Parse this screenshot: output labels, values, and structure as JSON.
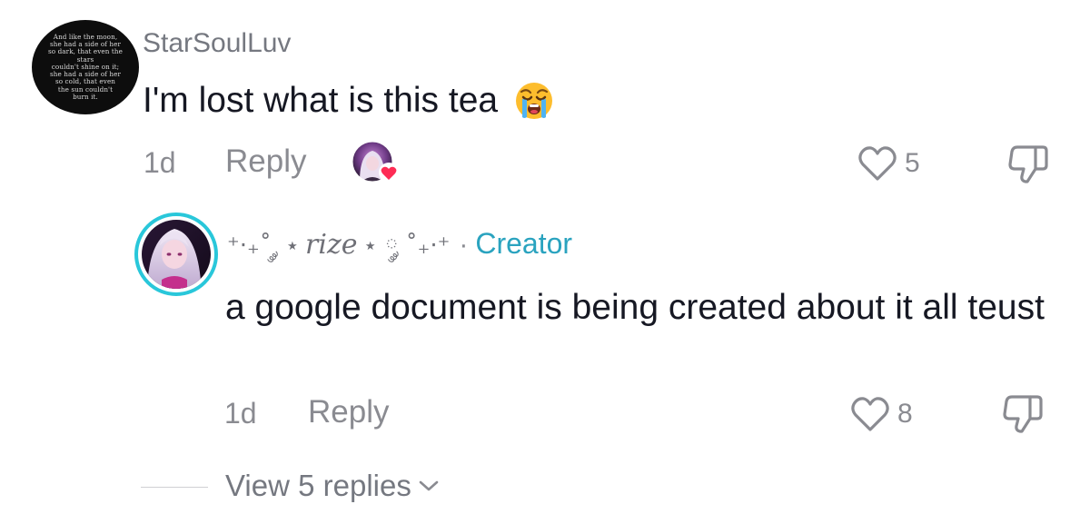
{
  "comment": {
    "username": "StarSoulLuv",
    "avatar_poem": [
      "And like the moon,",
      "she had a side of her",
      "so dark, that even the stars",
      "couldn't shine on it;",
      "she had a side of her",
      "so cold, that even",
      "the sun couldn't",
      "burn it."
    ],
    "text": "I'm lost what is this tea",
    "emoji": "loudly-crying-face-emoji",
    "time": "1d",
    "reply_label": "Reply",
    "liked_by_creator": true,
    "like_count": "5"
  },
  "reply": {
    "username_prefix": "⁺‧₊˚ ༘ ⋆",
    "username_name": "rize",
    "username_suffix": "⋆ ༘ ˚₊‧⁺",
    "creator_separator": "·",
    "creator_label": "Creator",
    "text": "a google document is being created about it all teust",
    "time": "1d",
    "reply_label": "Reply",
    "like_count": "8",
    "avatar_ring_color": "#29c7da"
  },
  "view_replies": {
    "label": "View 5 replies"
  },
  "colors": {
    "text_primary": "#161823",
    "text_secondary": "#8a8b91",
    "creator_accent": "#2aa3bf",
    "like_heart": "#fe2c55"
  }
}
